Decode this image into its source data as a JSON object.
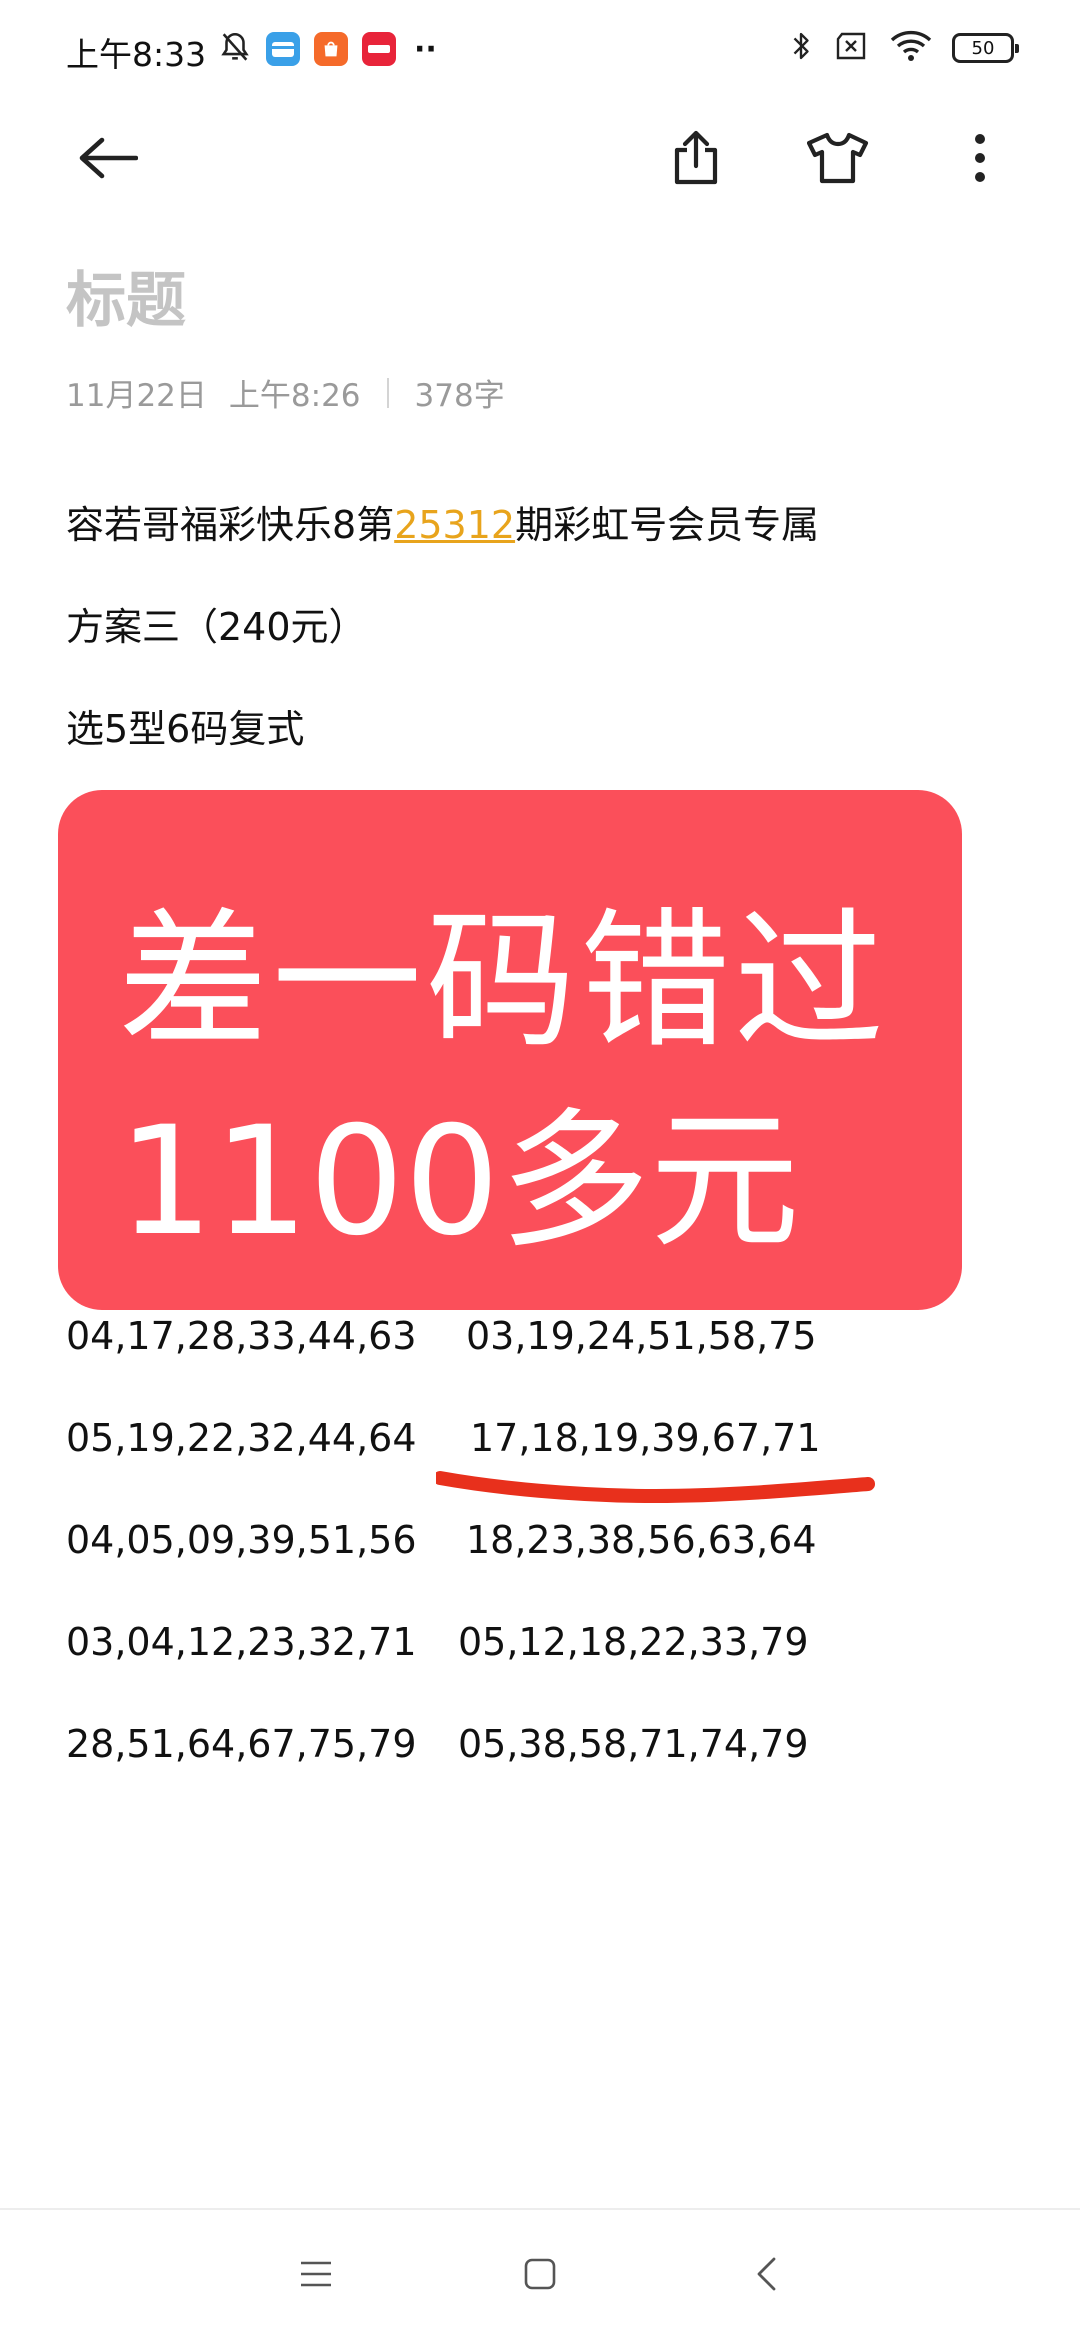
{
  "status_bar": {
    "time": "上午8:33",
    "battery": "50",
    "more_dots": "··"
  },
  "note": {
    "title_placeholder": "标题",
    "date": "11月22日",
    "time": "上午8:26",
    "char_count": "378字",
    "line1_prefix": "容若哥福彩快乐8第",
    "line1_issue": "25312",
    "line1_suffix": "期彩虹号会员专属",
    "line2": "方案三（240元）",
    "line3": "选5型6码复式"
  },
  "promo": {
    "line1": "差一码错过",
    "line2": "1100多元"
  },
  "number_rows": [
    {
      "left": "04,17,28,33,44,63",
      "right": "03,19,24,51,58,75"
    },
    {
      "left": "05,19,22,32,44,64",
      "right": "17,18,19,39,67,71"
    },
    {
      "left": "04,05,09,39,51,56",
      "right": "18,23,38,56,63,64"
    },
    {
      "left": "03,04,12,23,32,71",
      "right": "05,12,18,22,33,79"
    },
    {
      "left": "28,51,64,67,75,79",
      "right": "05,38,58,71,74,79"
    }
  ],
  "highlight": {
    "row": 2,
    "column": "right",
    "mark_color": "#e8301c"
  },
  "icons": {
    "back": "back-arrow-icon",
    "share": "share-icon",
    "theme": "tshirt-icon",
    "more": "more-vertical-icon",
    "nav_menu": "menu-icon",
    "nav_home": "home-square-icon",
    "nav_back": "back-chevron-icon"
  },
  "colors": {
    "promo_bg": "#fb4f5a",
    "link": "#e8a41c",
    "title_placeholder": "#c4c4c4"
  }
}
